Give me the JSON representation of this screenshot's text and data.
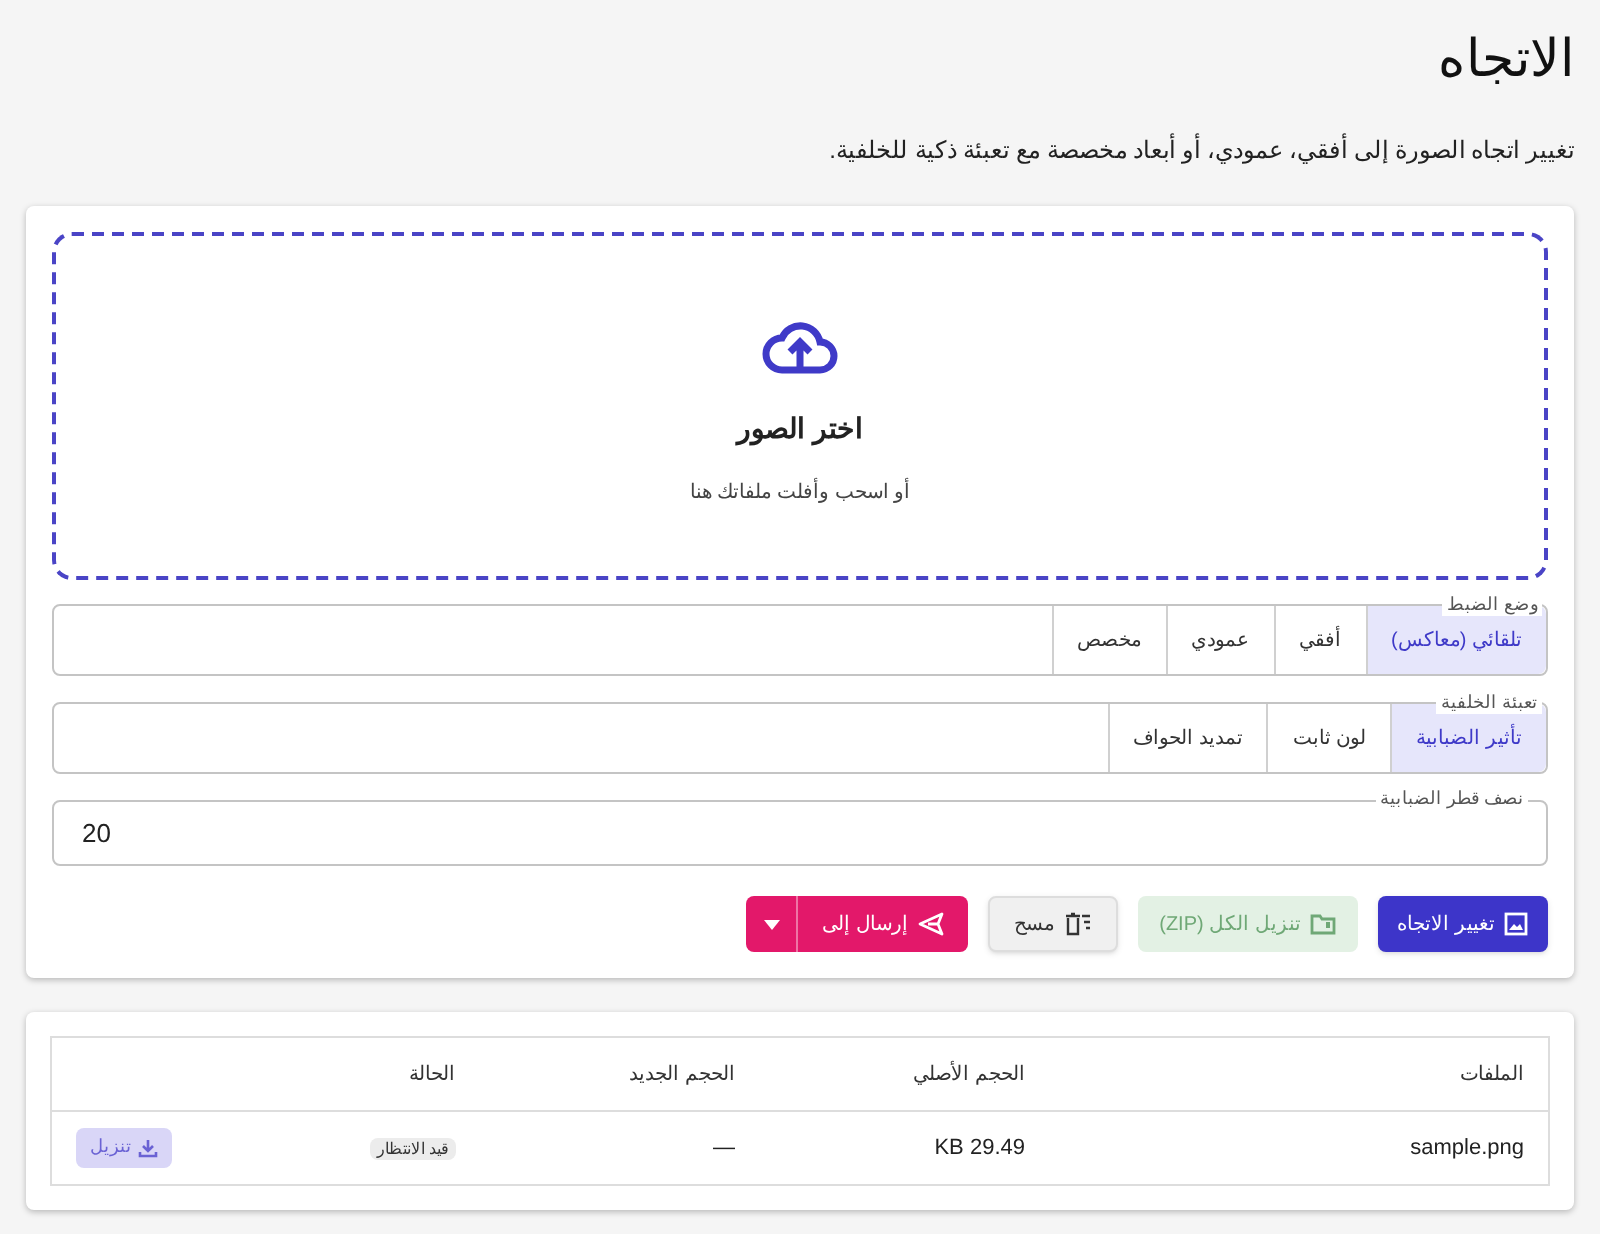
{
  "page": {
    "title": "الاتجاه",
    "description": "تغيير اتجاه الصورة إلى أفقي، عمودي، أو أبعاد مخصصة مع تعبئة ذكية للخلفية."
  },
  "dropzone": {
    "title": "اختر الصور",
    "hint": "أو اسحب وأفلت ملفاتك هنا"
  },
  "fit_mode": {
    "label": "وضع الضبط",
    "options": [
      {
        "label": "تلقائي (معاكس)",
        "selected": true
      },
      {
        "label": "أفقي",
        "selected": false
      },
      {
        "label": "عمودي",
        "selected": false
      },
      {
        "label": "مخصص",
        "selected": false
      }
    ]
  },
  "background_fill": {
    "label": "تعبئة الخلفية",
    "options": [
      {
        "label": "تأثير الضبابية",
        "selected": true
      },
      {
        "label": "لون ثابت",
        "selected": false
      },
      {
        "label": "تمديد الحواف",
        "selected": false
      }
    ]
  },
  "blur_radius": {
    "label": "نصف قطر الضبابية",
    "value": "20"
  },
  "actions": [
    {
      "kind": "primary",
      "label": "تغيير الاتجاه"
    },
    {
      "kind": "download_all",
      "label": "تنزيل الكل (ZIP)",
      "disabled": true
    },
    {
      "kind": "clear",
      "label": "مسح"
    },
    {
      "kind": "split",
      "label": "إرسال إلى"
    }
  ],
  "table": {
    "columns": [
      "الملفات",
      "الحجم الأصلي",
      "الحجم الجديد",
      "الحالة"
    ],
    "rows": [
      {
        "file": "sample.png",
        "original_size": "29.49 KB",
        "new_size": "—",
        "status": "قيد الانتظار",
        "action": {
          "label": "تنزيل",
          "disabled": true
        }
      }
    ]
  }
}
